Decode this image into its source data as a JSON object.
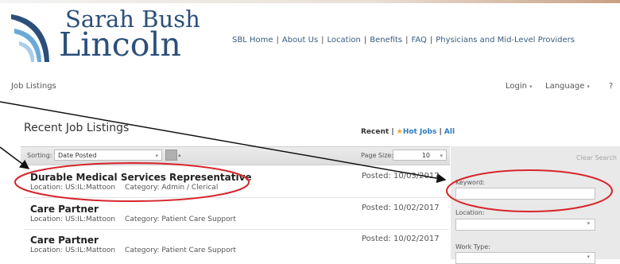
{
  "logo": {
    "line1": "Sarah Bush",
    "line2": "Lincoln"
  },
  "topnav": {
    "items": [
      "SBL Home",
      "About Us",
      "Location",
      "Benefits",
      "FAQ",
      "Physicians and Mid-Level Providers"
    ],
    "separator": "|"
  },
  "page_label": "Job Listings",
  "utility": {
    "login": "Login",
    "language": "Language",
    "help": "?"
  },
  "listing": {
    "heading": "Recent Job Listings",
    "filters": {
      "recent": "Recent",
      "sep": "|",
      "hot_jobs": "Hot Jobs",
      "all": "All"
    },
    "sorting_label": "Sorting:",
    "sorting_value": "Date Posted",
    "page_size_label": "Page Size:",
    "page_size_value": "10",
    "jobs": [
      {
        "title": "Durable Medical Services Representative",
        "location": "Location: US:IL:Mattoon",
        "category": "Category: Admin / Clerical",
        "posted": "Posted: 10/03/2017"
      },
      {
        "title": "Care Partner",
        "location": "Location: US:IL:Mattoon",
        "category": "Category: Patient Care Support",
        "posted": "Posted: 10/02/2017"
      },
      {
        "title": "Care Partner",
        "location": "Location: US:IL:Mattoon",
        "category": "Category: Patient Care Support",
        "posted": "Posted: 10/02/2017"
      }
    ]
  },
  "search": {
    "clear": "Clear Search",
    "keyword_label": "Keyword:",
    "keyword_value": "",
    "location_label": "Location:",
    "location_value": "",
    "worktype_label": "Work Type:",
    "worktype_value": ""
  },
  "colors": {
    "brand": "#2c4f7a",
    "link": "#2a7bc3",
    "star": "#f3a12b",
    "annotation": "#d6262c"
  }
}
